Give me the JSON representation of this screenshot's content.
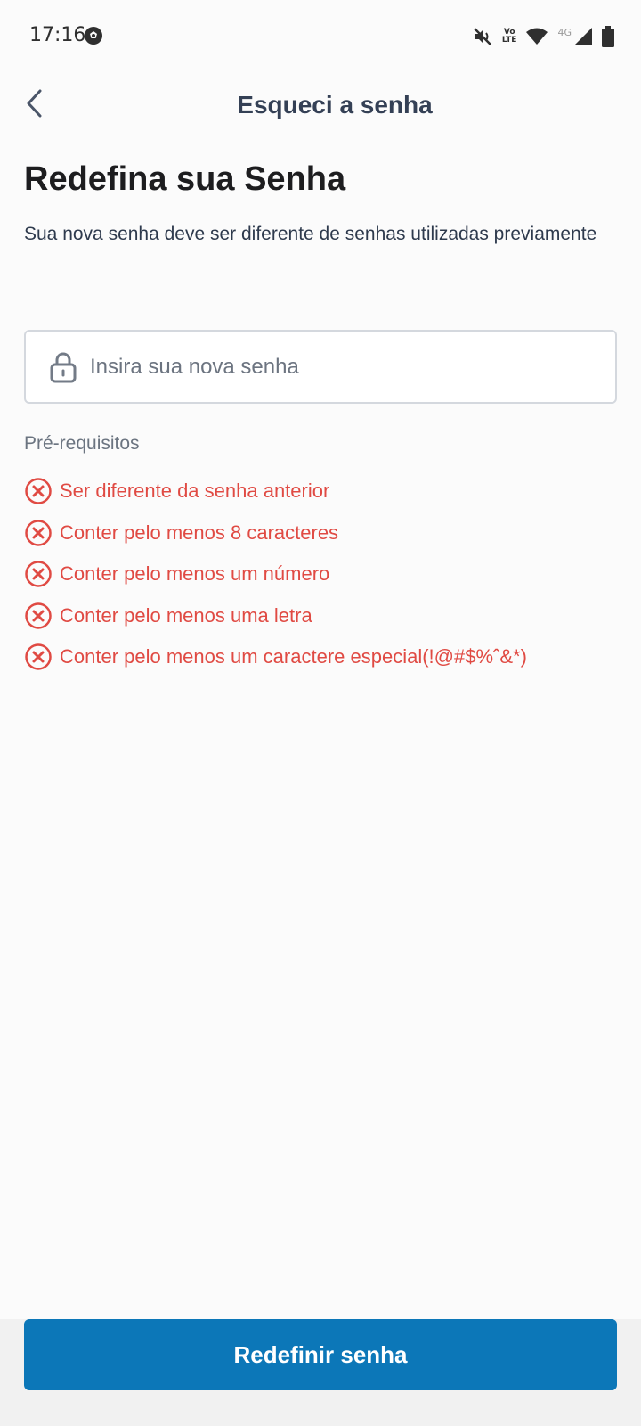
{
  "status_bar": {
    "time": "17:16",
    "volte_top": "Vo",
    "volte_bottom": "LTE",
    "network": "4G"
  },
  "header": {
    "back_icon": "chevron-left-icon",
    "title": "Esqueci a senha"
  },
  "main": {
    "title": "Redefina sua Senha",
    "subtitle": "Sua nova senha deve ser diferente de senhas utilizadas previamente",
    "password_field": {
      "icon": "lock-icon",
      "placeholder": "Insira sua nova senha",
      "value": ""
    },
    "requirements": {
      "title": "Pré-requisitos",
      "items": [
        {
          "label": "Ser diferente da senha anterior",
          "status": "unmet"
        },
        {
          "label": "Conter pelo menos 8 caracteres",
          "status": "unmet"
        },
        {
          "label": "Conter pelo menos um número",
          "status": "unmet"
        },
        {
          "label": "Conter pelo menos uma letra",
          "status": "unmet"
        },
        {
          "label": "Conter pelo menos um caractere especial(!@#$%ˆ&*)",
          "status": "unmet"
        }
      ]
    }
  },
  "footer": {
    "submit_label": "Redefinir senha"
  },
  "colors": {
    "primary": "#0c77b8",
    "error": "#e04a43",
    "title_text": "#1d1d1f",
    "header_text": "#344055"
  }
}
